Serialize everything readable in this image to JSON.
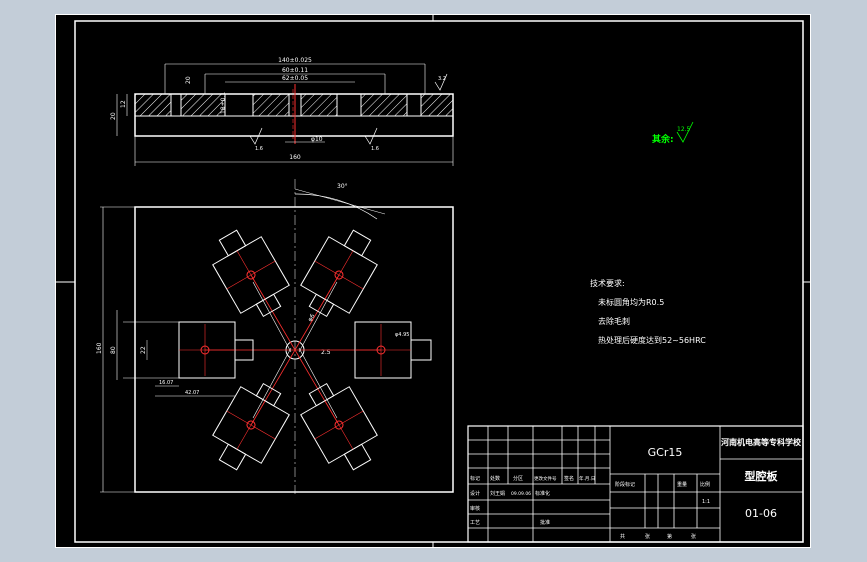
{
  "drawing": {
    "background": "#000000",
    "line_color": "#ffffff",
    "accent_color": "#ff3030",
    "green_text_color": "#00ff00",
    "title_color": "#ffffff"
  },
  "section_view": {
    "dims": {
      "overall_width": "140±0.025",
      "inner1": "60±0.11",
      "inner2": "62±0.05",
      "height_left": "12",
      "height_right": "20",
      "dim_small1": "20",
      "dim_small2": "18±0.1",
      "bottom_width": "160",
      "hole": "φ10",
      "roughness1": "3.2",
      "roughness2": "1.6",
      "roughness3": "1.6"
    }
  },
  "plan_view": {
    "angle": "30°",
    "dims": {
      "left_height": "160",
      "left_inner": "80",
      "cavity1": "22",
      "cavity2": "16.07",
      "cavity3": "42.07",
      "center_dia": "φ6",
      "center_dim": "2.5",
      "right_dim": "φ4.95"
    }
  },
  "surface_note": {
    "label": "其余:",
    "value": "12.5"
  },
  "tech_requirements": {
    "title": "技术要求:",
    "items": [
      "未标圆角均为R0.5",
      "去除毛刺",
      "热处理后硬度达到52~56HRC"
    ]
  },
  "title_block": {
    "material": "GCr15",
    "school": "河南机电高等专科学校",
    "part_name": "型腔板",
    "drawing_no": "01-06",
    "scale_value": "1:1",
    "row_marker": [
      "标记",
      "处数",
      "分区",
      "更改文件号",
      "签名",
      "年.月.日"
    ],
    "row_design": [
      "设计",
      "刘王娟",
      "09.09.06",
      "标准化"
    ],
    "row_review": "审核",
    "row_process": "工艺",
    "row_approve": "批准",
    "stage_labels": [
      "阶段标记",
      "重量",
      "比例"
    ],
    "sheet_labels": [
      "共",
      "张",
      "第",
      "张"
    ]
  }
}
